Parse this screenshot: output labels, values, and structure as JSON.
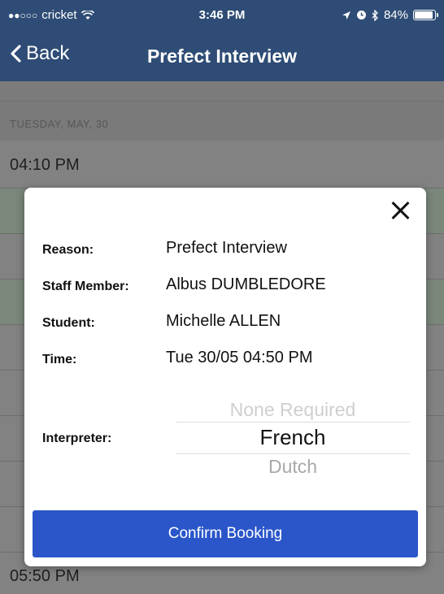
{
  "status_bar": {
    "carrier": "cricket",
    "time": "3:46 PM",
    "battery": "84%",
    "battery_level": 0.84
  },
  "nav": {
    "back_label": "Back",
    "title": "Prefect Interview"
  },
  "background": {
    "date_header": "TUESDAY, MAY, 30",
    "first_slot": "04:10 PM",
    "last_slot": "05:50 PM"
  },
  "modal": {
    "details": [
      {
        "label": "Reason:",
        "value": "Prefect Interview"
      },
      {
        "label": "Staff Member:",
        "value": "Albus DUMBLEDORE"
      },
      {
        "label": "Student:",
        "value": "Michelle ALLEN"
      },
      {
        "label": "Time:",
        "value": "Tue 30/05 04:50 PM"
      }
    ],
    "interpreter_label": "Interpreter:",
    "interpreter_options": [
      "None Required",
      "French",
      "Dutch"
    ],
    "interpreter_selected": "French",
    "confirm_label": "Confirm Booking"
  },
  "colors": {
    "nav_background": "#2e4c75",
    "confirm_button": "#2a56c9"
  }
}
